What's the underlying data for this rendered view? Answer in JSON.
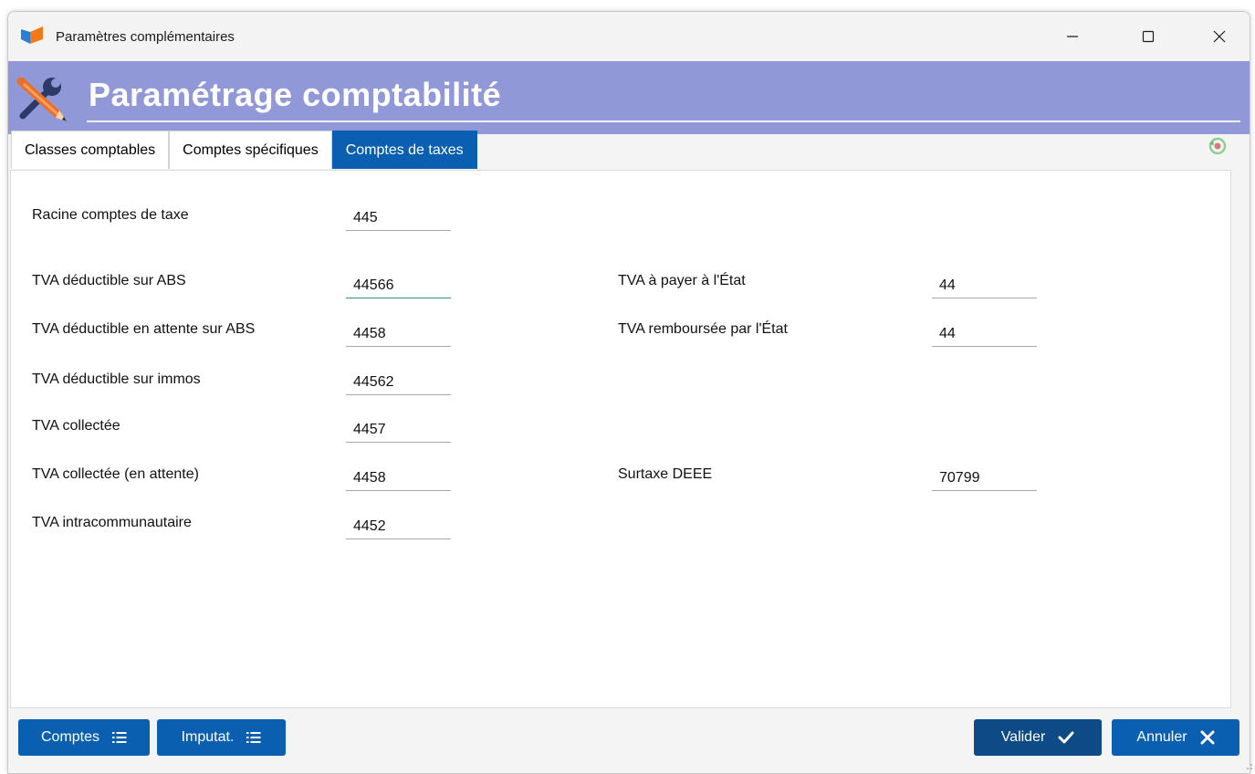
{
  "window": {
    "title": "Paramètres complémentaires",
    "controls": [
      "minimize-icon",
      "maximize-icon",
      "close-icon"
    ]
  },
  "banner": {
    "title": "Paramétrage comptabilité",
    "icon": "tools-icon"
  },
  "tabs": [
    {
      "label": "Classes comptables",
      "active": false
    },
    {
      "label": "Comptes spécifiques",
      "active": false
    },
    {
      "label": "Comptes de taxes",
      "active": true
    }
  ],
  "form": {
    "racine": {
      "label": "Racine comptes de taxe",
      "value": "445"
    },
    "tva_deductible_abs": {
      "label": "TVA déductible sur ABS",
      "value": "44566"
    },
    "tva_deductible_attente_abs": {
      "label": "TVA déductible en attente sur ABS",
      "value": "4458"
    },
    "tva_deductible_immos": {
      "label": "TVA déductible sur immos",
      "value": "44562"
    },
    "tva_collectee": {
      "label": "TVA collectée",
      "value": "4457"
    },
    "tva_collectee_attente": {
      "label": "TVA collectée (en attente)",
      "value": "4458"
    },
    "tva_intracom": {
      "label": "TVA intracommunautaire",
      "value": "4452"
    },
    "tva_a_payer": {
      "label": "TVA à payer à l'État",
      "value": "44"
    },
    "tva_remboursee": {
      "label": "TVA remboursée par l'État",
      "value": "44"
    },
    "surtaxe_deee": {
      "label": "Surtaxe DEEE",
      "value": "70799"
    }
  },
  "footer": {
    "comptes_label": "Comptes",
    "imputat_label": "Imputat.",
    "valider_label": "Valider",
    "annuler_label": "Annuler"
  },
  "colors": {
    "banner": "#9198d8",
    "accent": "#0a5fb0",
    "accent_dark": "#0d4a86"
  }
}
